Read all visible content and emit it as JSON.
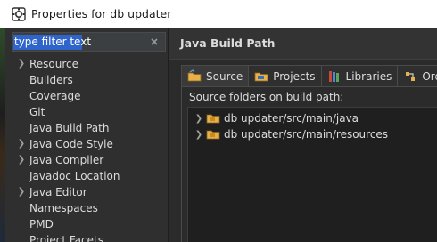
{
  "window": {
    "title": "Properties for db updater"
  },
  "filter": {
    "value": "type filter text"
  },
  "nav": {
    "items": [
      {
        "label": "Resource",
        "expandable": true
      },
      {
        "label": "Builders",
        "expandable": false
      },
      {
        "label": "Coverage",
        "expandable": false
      },
      {
        "label": "Git",
        "expandable": false
      },
      {
        "label": "Java Build Path",
        "expandable": false
      },
      {
        "label": "Java Code Style",
        "expandable": true
      },
      {
        "label": "Java Compiler",
        "expandable": true
      },
      {
        "label": "Javadoc Location",
        "expandable": false
      },
      {
        "label": "Java Editor",
        "expandable": true
      },
      {
        "label": "Namespaces",
        "expandable": false
      },
      {
        "label": "PMD",
        "expandable": false
      },
      {
        "label": "Project Facets",
        "expandable": false
      }
    ]
  },
  "page": {
    "title": "Java Build Path"
  },
  "tabs": [
    {
      "label": "Source",
      "icon": "source-folder-icon",
      "active": true
    },
    {
      "label": "Projects",
      "icon": "projects-icon",
      "active": false
    },
    {
      "label": "Libraries",
      "icon": "libraries-icon",
      "active": false
    },
    {
      "label": "Order",
      "icon": "order-export-icon",
      "active": false
    }
  ],
  "source": {
    "heading": "Source folders on build path:",
    "folders": [
      {
        "path": "db updater/src/main/java"
      },
      {
        "path": "db updater/src/main/resources"
      }
    ]
  },
  "colors": {
    "selection": "#2f65ca",
    "background": "#2b2b2b",
    "folder": "#e8b04a"
  }
}
